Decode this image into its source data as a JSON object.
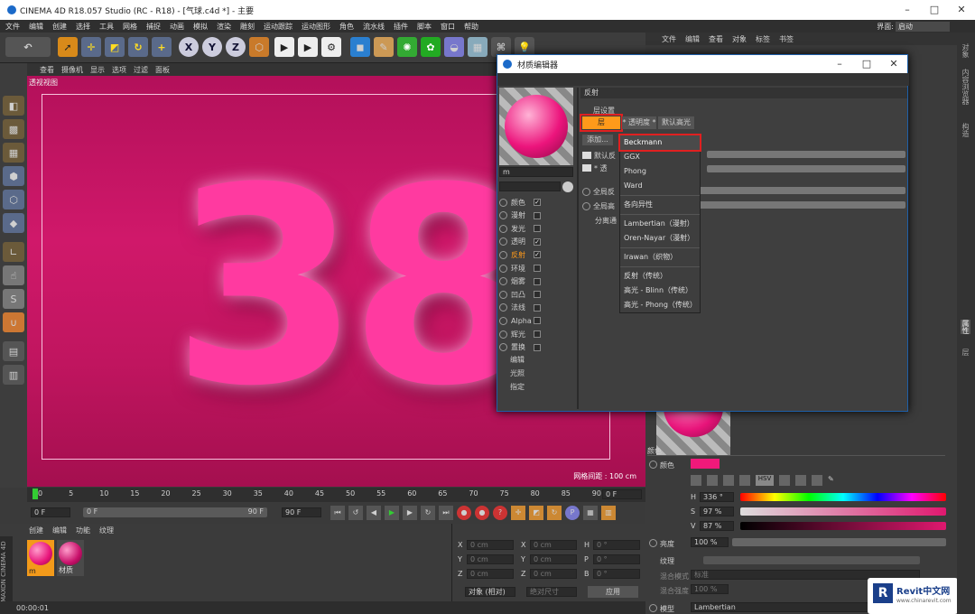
{
  "app": {
    "title": "CINEMA 4D R18.057 Studio (RC - R18) - [气球.c4d *] - 主要",
    "menus": [
      "文件",
      "编辑",
      "创建",
      "选择",
      "工具",
      "网格",
      "捕捉",
      "动画",
      "模拟",
      "渲染",
      "雕刻",
      "运动跟踪",
      "运动图形",
      "角色",
      "流水线",
      "插件",
      "脚本",
      "窗口",
      "帮助"
    ],
    "layout_label": "界面:",
    "layout_value": "启动"
  },
  "toolbar_icons": [
    "undo-icon",
    "select-arrow-icon",
    "move-icon",
    "scale-icon",
    "rotate-icon",
    "add-icon",
    "x-axis-icon",
    "y-axis-icon",
    "z-axis-icon",
    "coord-icon",
    "render-view-icon",
    "render-icon",
    "render-settings-icon",
    "cube-icon",
    "pen-icon",
    "subdivide-icon",
    "cloner-icon",
    "deformer-icon",
    "floor-icon",
    "camera-icon",
    "light-icon"
  ],
  "viewport": {
    "menu": [
      "查看",
      "摄像机",
      "显示",
      "选项",
      "过滤",
      "面板"
    ],
    "name": "透视视图",
    "grid_label": "网格间距 : 100 cm",
    "content": "38"
  },
  "timeline": {
    "ticks": [
      "0",
      "5",
      "10",
      "15",
      "20",
      "25",
      "30",
      "35",
      "40",
      "45",
      "50",
      "55",
      "60",
      "65",
      "70",
      "75",
      "80",
      "85",
      "90"
    ],
    "frame_field": "0 F",
    "start_field": "0 F",
    "range_start": "0 F",
    "range_end": "90 F",
    "end_field": "90 F"
  },
  "material_manager": {
    "menu": [
      "创建",
      "编辑",
      "功能",
      "纹理"
    ],
    "materials": [
      {
        "name": "m"
      },
      {
        "name": "材质"
      }
    ]
  },
  "coordinates": {
    "rows": [
      {
        "a": "X",
        "av": "0 cm",
        "b": "X",
        "bv": "0 cm",
        "c": "H",
        "cv": "0 °"
      },
      {
        "a": "Y",
        "av": "0 cm",
        "b": "Y",
        "bv": "0 cm",
        "c": "P",
        "cv": "0 °"
      },
      {
        "a": "Z",
        "av": "0 cm",
        "b": "Z",
        "bv": "0 cm",
        "c": "B",
        "cv": "0 °"
      }
    ],
    "mode": "对象 (相对)",
    "size_mode": "绝对尺寸",
    "apply": "应用"
  },
  "status": {
    "time": "00:00:01"
  },
  "object_manager": {
    "menu": [
      "文件",
      "编辑",
      "查看",
      "对象",
      "标签",
      "书签"
    ]
  },
  "dialog": {
    "title": "材质编辑器",
    "mat_name": "m",
    "channels": [
      {
        "label": "颜色",
        "checked": true
      },
      {
        "label": "漫射",
        "checked": false
      },
      {
        "label": "发光",
        "checked": false
      },
      {
        "label": "透明",
        "checked": true
      },
      {
        "label": "反射",
        "checked": true,
        "active": true
      },
      {
        "label": "环境",
        "checked": false
      },
      {
        "label": "烟雾",
        "checked": false
      },
      {
        "label": "凹凸",
        "checked": false
      },
      {
        "label": "法线",
        "checked": false
      },
      {
        "label": "Alpha",
        "checked": false
      },
      {
        "label": "辉光",
        "checked": false
      },
      {
        "label": "置换",
        "checked": false
      }
    ],
    "extra_items": [
      "编辑",
      "光照",
      "指定"
    ],
    "section": "反射",
    "layer_settings": "层设置",
    "tabs": [
      "层",
      "* 透明度 *",
      "默认高光"
    ],
    "add_button": "添加...",
    "layer_rows": [
      "默认反",
      "* 透"
    ],
    "global_rows": [
      "全局反",
      "全局高"
    ],
    "sep_label": "分离通",
    "dropdown": [
      "Beckmann",
      "GGX",
      "Phong",
      "Ward",
      "各向异性",
      "Lambertian（漫射）",
      "Oren-Nayar（漫射）",
      "Irawan（织物）",
      "反射（传统）",
      "高光 - Blinn（传统）",
      "高光 - Phong（传统）"
    ]
  },
  "attributes": {
    "section": "颜色",
    "color_label": "颜色",
    "h_label": "H",
    "h_value": "336 °",
    "s_label": "S",
    "s_value": "97 %",
    "v_label": "V",
    "v_value": "87 %",
    "brightness_label": "亮度",
    "brightness_value": "100 %",
    "texture_label": "纹理",
    "blend_mode_label": "混合模式",
    "blend_mode_value": "标准",
    "blend_strength_label": "混合强度",
    "blend_strength_value": "100 %",
    "model_label": "模型",
    "model_value": "Lambertian",
    "tabs": [
      "属性",
      "层"
    ]
  },
  "right_strip_tabs": [
    "对象",
    "内容浏览器",
    "构造",
    "属性",
    "层"
  ],
  "watermark": {
    "brand": "Revit中文网",
    "url": "www.chinarevit.com"
  },
  "colors": {
    "accent": "#f0197a",
    "selected_orange": "#ff9a1a",
    "highlight_red": "#e02020"
  }
}
